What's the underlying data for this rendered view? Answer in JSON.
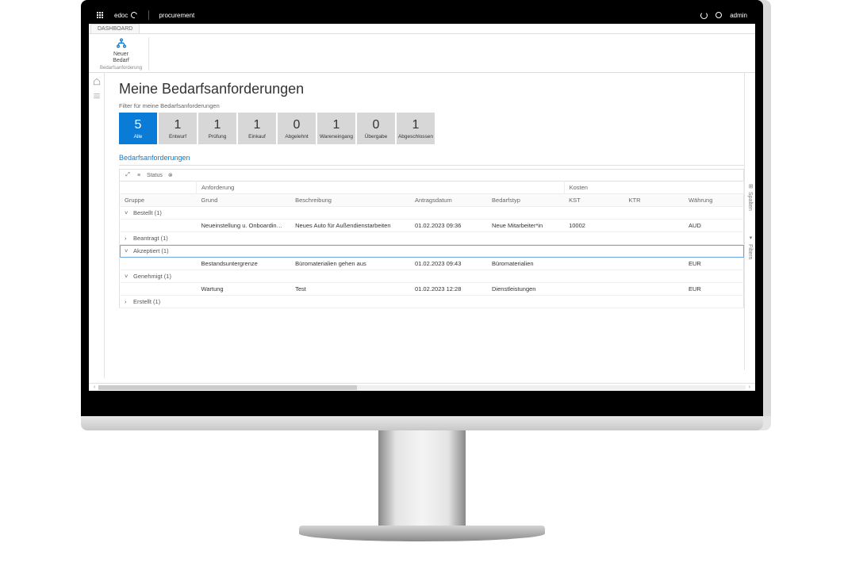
{
  "topbar": {
    "brand": "edoc",
    "app": "procurement",
    "user": "admin"
  },
  "ribbon": {
    "tab": "DASHBOARD",
    "new_btn_line1": "Neuer",
    "new_btn_line2": "Bedarf",
    "group_title": "Bedarfsanforderung"
  },
  "page": {
    "title": "Meine Bedarfsanforderungen",
    "filter_label": "Filter für meine Bedarfsanforderungen"
  },
  "tiles": [
    {
      "count": "5",
      "label": "Alle",
      "active": true
    },
    {
      "count": "1",
      "label": "Entwurf",
      "active": false
    },
    {
      "count": "1",
      "label": "Prüfung",
      "active": false
    },
    {
      "count": "1",
      "label": "Einkauf",
      "active": false
    },
    {
      "count": "0",
      "label": "Abgelehnt",
      "active": false
    },
    {
      "count": "1",
      "label": "Wareneingang",
      "active": false
    },
    {
      "count": "0",
      "label": "Übergabe",
      "active": false
    },
    {
      "count": "1",
      "label": "Abgeschlossen",
      "active": false
    }
  ],
  "grid": {
    "section_title": "Bedarfsanforderungen",
    "toolbar_status": "Status",
    "sup_headers": {
      "anforderung": "Anforderung",
      "kosten": "Kosten"
    },
    "columns": {
      "gruppe": "Gruppe",
      "grund": "Grund",
      "beschreibung": "Beschreibung",
      "antragsdatum": "Antragsdatum",
      "bedarfstyp": "Bedarfstyp",
      "kst": "KST",
      "ktr": "KTR",
      "waehrung": "Währung"
    },
    "groups": [
      {
        "label": "Bestellt (1)",
        "expanded": true,
        "selected": false,
        "rows": [
          {
            "grund": "Neueinstellung u. Onboarding ...",
            "beschreibung": "Neues Auto für Außendienstarbeiten",
            "antragsdatum": "01.02.2023 09:36",
            "bedarfstyp": "Neue Mitarbeiter*in",
            "kst": "10002",
            "ktr": "",
            "waehrung": "AUD"
          }
        ]
      },
      {
        "label": "Beantragt (1)",
        "expanded": false,
        "selected": false,
        "rows": []
      },
      {
        "label": "Akzeptiert (1)",
        "expanded": true,
        "selected": true,
        "rows": [
          {
            "grund": "Bestandsuntergrenze",
            "beschreibung": "Büromaterialien gehen aus",
            "antragsdatum": "01.02.2023 09:43",
            "bedarfstyp": "Büromaterialien",
            "kst": "",
            "ktr": "",
            "waehrung": "EUR"
          }
        ]
      },
      {
        "label": "Genehmigt (1)",
        "expanded": true,
        "selected": false,
        "rows": [
          {
            "grund": "Wartung",
            "beschreibung": "Test",
            "antragsdatum": "01.02.2023 12:28",
            "bedarfstyp": "Dienstleistungen",
            "kst": "",
            "ktr": "",
            "waehrung": "EUR"
          }
        ]
      },
      {
        "label": "Erstellt (1)",
        "expanded": false,
        "selected": false,
        "rows": []
      }
    ]
  },
  "rightbar": {
    "columns": "Spalten",
    "filters": "Filtern"
  }
}
